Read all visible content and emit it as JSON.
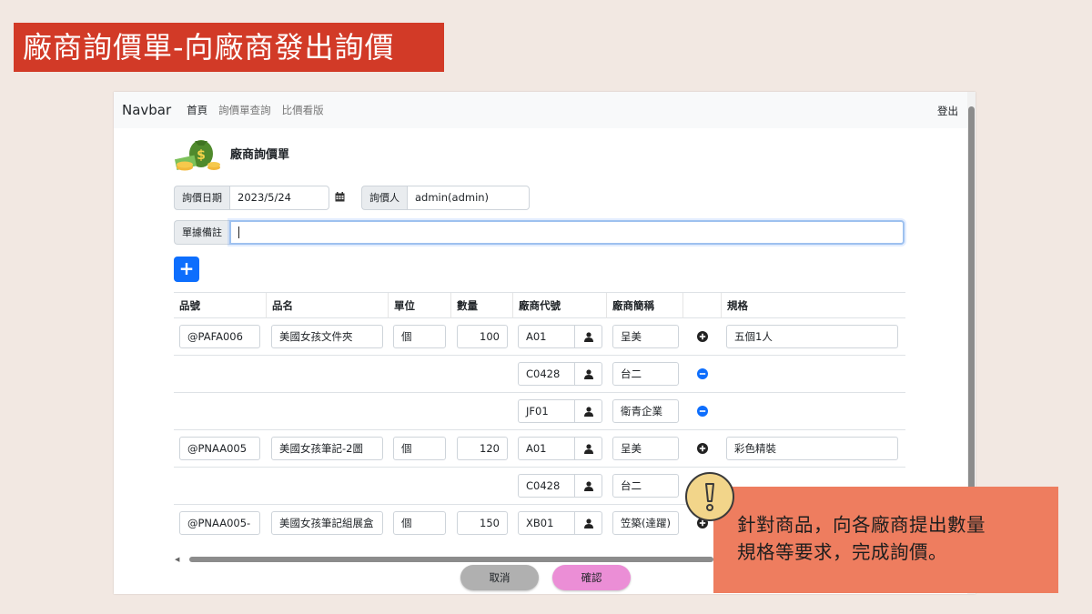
{
  "banner": {
    "title": "廠商詢價單-向廠商發出詢價"
  },
  "navbar": {
    "brand": "Navbar",
    "links": [
      "首頁",
      "詢價單查詢",
      "比價看版"
    ],
    "logout": "登出"
  },
  "page": {
    "title": "廠商詢價單"
  },
  "form": {
    "date_label": "詢價日期",
    "date_value": "2023/5/24",
    "inquirer_label": "詢價人",
    "inquirer_value": "admin(admin)",
    "note_label": "單據備註",
    "note_value": ""
  },
  "add_button": "+",
  "table": {
    "headers": [
      "品號",
      "品名",
      "單位",
      "數量",
      "廠商代號",
      "廠商簡稱",
      "",
      "規格"
    ],
    "rows": [
      {
        "item_no": "@PAFA006",
        "item_name": "美國女孩文件夾",
        "unit": "個",
        "qty": "100",
        "vendor_code": "A01",
        "vendor_name": "呈美",
        "action": "add",
        "spec": "五個1人"
      },
      {
        "item_no": "",
        "item_name": "",
        "unit": "",
        "qty": "",
        "vendor_code": "C0428",
        "vendor_name": "台二",
        "action": "remove",
        "spec": ""
      },
      {
        "item_no": "",
        "item_name": "",
        "unit": "",
        "qty": "",
        "vendor_code": "JF01",
        "vendor_name": "衛青企業",
        "action": "remove",
        "spec": ""
      },
      {
        "item_no": "@PNAA005",
        "item_name": "美國女孩筆記-2圖",
        "unit": "個",
        "qty": "120",
        "vendor_code": "A01",
        "vendor_name": "呈美",
        "action": "add",
        "spec": "彩色精裝"
      },
      {
        "item_no": "",
        "item_name": "",
        "unit": "",
        "qty": "",
        "vendor_code": "C0428",
        "vendor_name": "台二",
        "action": "",
        "spec": ""
      },
      {
        "item_no": "@PNAA005-",
        "item_name": "美國女孩筆記組展盒",
        "unit": "個",
        "qty": "150",
        "vendor_code": "XB01",
        "vendor_name": "笠築(達躍)",
        "action": "add",
        "spec": ""
      }
    ]
  },
  "buttons": {
    "cancel": "取消",
    "confirm": "確認"
  },
  "callout": {
    "line1": "針對商品，向各廠商提出數量",
    "line2": "規格等要求，完成詢價。"
  },
  "colors": {
    "banner": "#d23a27",
    "primary": "#0d6efd",
    "callout": "#ee7d5f",
    "confirm": "#eb8ed6",
    "cancel": "#b0b0b0"
  }
}
